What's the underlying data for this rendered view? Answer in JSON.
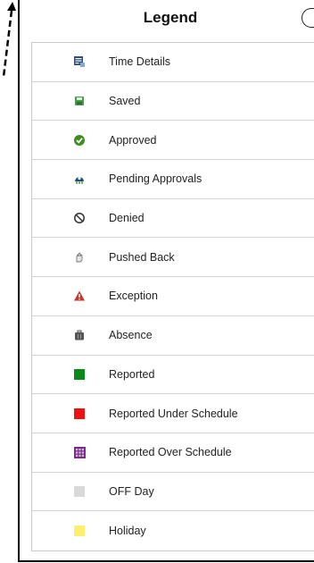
{
  "legend": {
    "title": "Legend",
    "close_glyph": "×",
    "items": [
      {
        "label": "Time Details",
        "icon": "time-details-icon"
      },
      {
        "label": "Saved",
        "icon": "saved-icon",
        "color": "#4a9a4a"
      },
      {
        "label": "Approved",
        "icon": "approved-check-icon",
        "color": "#3e8e1f"
      },
      {
        "label": "Pending Approvals",
        "icon": "pending-approvals-icon",
        "color": "#1f4e79"
      },
      {
        "label": "Denied",
        "icon": "denied-icon",
        "color": "#333333"
      },
      {
        "label": "Pushed Back",
        "icon": "pushed-back-hand-icon",
        "color": "#888888"
      },
      {
        "label": "Exception",
        "icon": "exception-warning-icon",
        "color": "#c0392b"
      },
      {
        "label": "Absence",
        "icon": "absence-briefcase-icon",
        "color": "#555555"
      },
      {
        "label": "Reported",
        "icon": "reported-square",
        "color": "#0a8a1a"
      },
      {
        "label": "Reported Under Schedule",
        "icon": "reported-under-schedule-square",
        "color": "#ee1111"
      },
      {
        "label": "Reported Over Schedule",
        "icon": "reported-over-schedule-square",
        "color": "#7a2e8a"
      },
      {
        "label": "OFF Day",
        "icon": "off-day-square",
        "color": "#d9d9d9"
      },
      {
        "label": "Holiday",
        "icon": "holiday-square",
        "color": "#ffef6e"
      }
    ]
  }
}
